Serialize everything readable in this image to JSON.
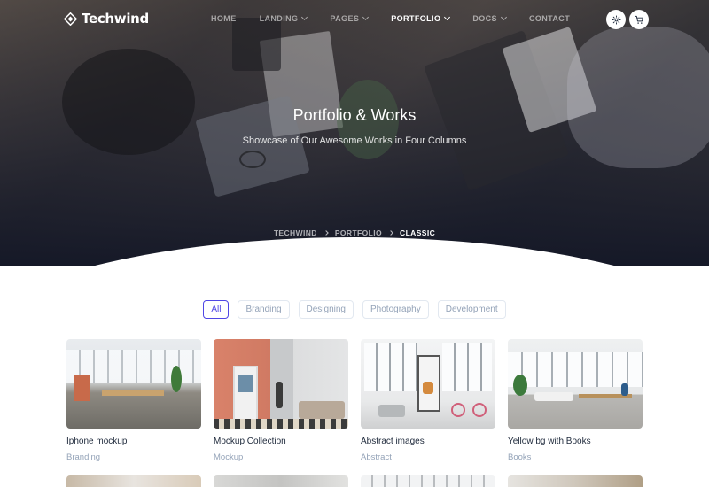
{
  "brand": {
    "name": "Techwind"
  },
  "nav": {
    "items": [
      {
        "label": "HOME",
        "dropdown": false,
        "active": false
      },
      {
        "label": "LANDING",
        "dropdown": true,
        "active": false
      },
      {
        "label": "PAGES",
        "dropdown": true,
        "active": false
      },
      {
        "label": "PORTFOLIO",
        "dropdown": true,
        "active": true
      },
      {
        "label": "DOCS",
        "dropdown": true,
        "active": false
      },
      {
        "label": "CONTACT",
        "dropdown": false,
        "active": false
      }
    ],
    "icons": [
      "gear-icon",
      "cart-icon"
    ]
  },
  "hero": {
    "title": "Portfolio & Works",
    "subtitle": "Showcase of Our Awesome Works in Four Columns",
    "breadcrumb": [
      "TECHWIND",
      "PORTFOLIO",
      "CLASSIC"
    ]
  },
  "filters": {
    "items": [
      "All",
      "Branding",
      "Designing",
      "Photography",
      "Development"
    ],
    "active": "All"
  },
  "portfolio": {
    "items": [
      {
        "title": "Iphone mockup",
        "category": "Branding"
      },
      {
        "title": "Mockup Collection",
        "category": "Mockup"
      },
      {
        "title": "Abstract images",
        "category": "Abstract"
      },
      {
        "title": "Yellow bg with Books",
        "category": "Books"
      }
    ]
  },
  "colors": {
    "accent": "#4f46e5",
    "muted": "#94a3b8",
    "hero_overlay": "#161a2a"
  }
}
